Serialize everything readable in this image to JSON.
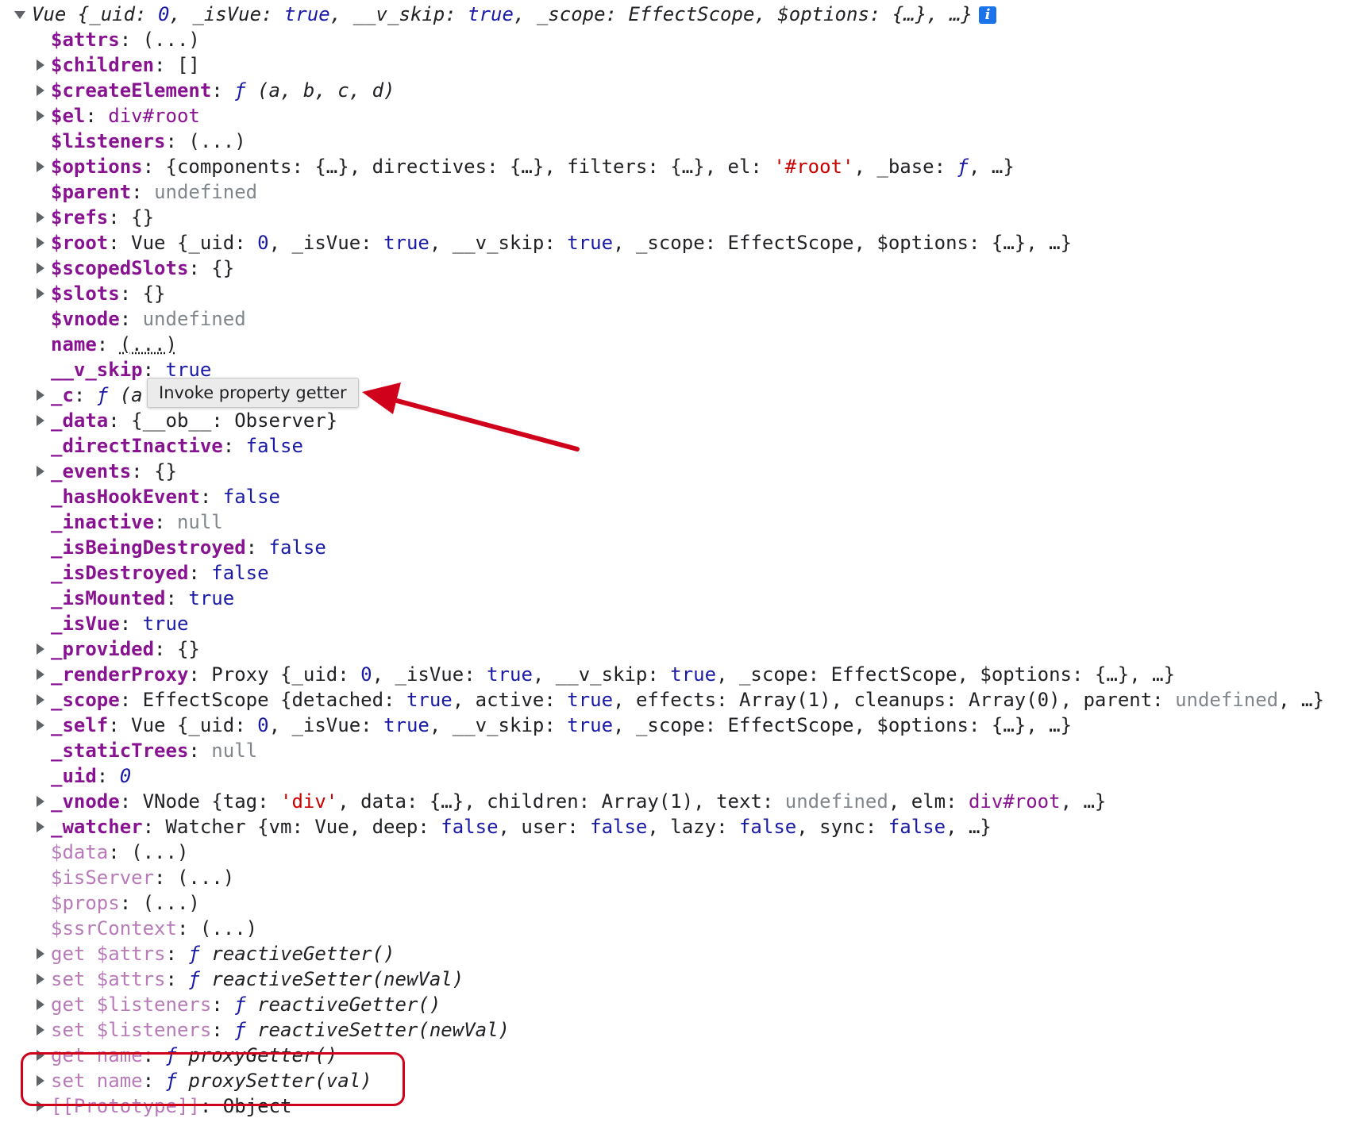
{
  "header": {
    "object_label": "Vue",
    "summary_open": "{",
    "s1k": "_uid",
    "s1v": "0",
    "s2k": "_isVue",
    "s2v": "true",
    "s3k": "__v_skip",
    "s3v": "true",
    "s4k": "_scope",
    "s4v": "EffectScope",
    "s5k": "$options",
    "s5v": "{…}",
    "summary_close": "…}",
    "info_icon": "i"
  },
  "tooltip": {
    "text": "Invoke property getter"
  },
  "props": {
    "attrs": {
      "key": "$attrs",
      "value": "(...)"
    },
    "children": {
      "key": "$children",
      "value": "[]"
    },
    "createElement": {
      "key": "$createElement",
      "f": "ƒ",
      "sig": "(a, b, c, d)"
    },
    "el": {
      "key": "$el",
      "value": "div#root"
    },
    "listeners": {
      "key": "$listeners",
      "value": "(...)"
    },
    "options": {
      "key": "$options",
      "p1": "{components: {…}, directives: {…}, filters: {…}, el: ",
      "str": "'#root'",
      "p2": ", _base: ",
      "f": "ƒ",
      "p3": ", …}"
    },
    "parent": {
      "key": "$parent",
      "value": "undefined"
    },
    "refs": {
      "key": "$refs",
      "value": "{}"
    },
    "root": {
      "key": "$root",
      "pre": "Vue {_uid: ",
      "uid": "0",
      "m1": ", _isVue: ",
      "v1": "true",
      "m2": ", __v_skip: ",
      "v2": "true",
      "m3": ", _scope: EffectScope, $options: {…}, …}"
    },
    "scopedSlots": {
      "key": "$scopedSlots",
      "value": "{}"
    },
    "slots": {
      "key": "$slots",
      "value": "{}"
    },
    "vnode": {
      "key": "$vnode",
      "value": "undefined"
    },
    "name": {
      "key": "name",
      "value": "(...)"
    },
    "v_skip": {
      "key": "__v_skip",
      "value": "true"
    },
    "c": {
      "key": "_c",
      "f": "ƒ",
      "sig": "(a"
    },
    "data": {
      "key": "_data",
      "value": "{__ob__: Observer}"
    },
    "directInactive": {
      "key": "_directInactive",
      "value": "false"
    },
    "events": {
      "key": "_events",
      "value": "{}"
    },
    "hasHookEvent": {
      "key": "_hasHookEvent",
      "value": "false"
    },
    "inactive": {
      "key": "_inactive",
      "value": "null"
    },
    "isBeingDestroyed": {
      "key": "_isBeingDestroyed",
      "value": "false"
    },
    "isDestroyed": {
      "key": "_isDestroyed",
      "value": "false"
    },
    "isMounted": {
      "key": "_isMounted",
      "value": "true"
    },
    "isVue": {
      "key": "_isVue",
      "value": "true"
    },
    "provided": {
      "key": "_provided",
      "value": "{}"
    },
    "renderProxy": {
      "key": "_renderProxy",
      "pre": "Proxy {_uid: ",
      "uid": "0",
      "m1": ", _isVue: ",
      "v1": "true",
      "m2": ", __v_skip: ",
      "v2": "true",
      "m3": ", _scope: EffectScope, $options: {…}, …}"
    },
    "scope": {
      "key": "_scope",
      "pre": "EffectScope {detached: ",
      "v1": "true",
      "m1": ", active: ",
      "v2": "true",
      "m2": ", effects: Array(1), cleanups: Array(0), parent: ",
      "u": "undefined",
      "m3": ", …}"
    },
    "self": {
      "key": "_self",
      "pre": "Vue {_uid: ",
      "uid": "0",
      "m1": ", _isVue: ",
      "v1": "true",
      "m2": ", __v_skip: ",
      "v2": "true",
      "m3": ", _scope: EffectScope, $options: {…}, …}"
    },
    "staticTrees": {
      "key": "_staticTrees",
      "value": "null"
    },
    "uid": {
      "key": "_uid",
      "value": "0"
    },
    "vnode2": {
      "key": "_vnode",
      "pre": "VNode {tag: ",
      "str": "'div'",
      "m1": ", data: {…}, children: Array(1), text: ",
      "u": "undefined",
      "m2": ", elm: ",
      "el": "div#root",
      "m3": ", …}"
    },
    "watcher": {
      "key": "_watcher",
      "pre": "Watcher {vm: Vue, deep: ",
      "v1": "false",
      "m1": ", user: ",
      "v2": "false",
      "m2": ", lazy: ",
      "v3": "false",
      "m3": ", sync: ",
      "v4": "false",
      "m4": ", …}"
    },
    "dollarData": {
      "key": "$data",
      "value": "(...)"
    },
    "isServer": {
      "key": "$isServer",
      "value": "(...)"
    },
    "dollarProps": {
      "key": "$props",
      "value": "(...)"
    },
    "ssrContext": {
      "key": "$ssrContext",
      "value": "(...)"
    },
    "getAttrs": {
      "key": "get $attrs",
      "f": "ƒ",
      "fn": "reactiveGetter()"
    },
    "setAttrs": {
      "key": "set $attrs",
      "f": "ƒ",
      "fn": "reactiveSetter(newVal)"
    },
    "getListeners": {
      "key": "get $listeners",
      "f": "ƒ",
      "fn": "reactiveGetter()"
    },
    "setListeners": {
      "key": "set $listeners",
      "f": "ƒ",
      "fn": "reactiveSetter(newVal)"
    },
    "getName": {
      "key": "get name",
      "f": "ƒ",
      "fn": "proxyGetter()"
    },
    "setName": {
      "key": "set name",
      "f": "ƒ",
      "fn": "proxySetter(val)"
    },
    "prototype": {
      "key": "[[Prototype]]",
      "value": "Object"
    }
  },
  "colors": {
    "annotation_red": "#d0021b",
    "key_purple": "#881391",
    "boolean_blue": "#1a1aa6",
    "string_red": "#c80000"
  }
}
